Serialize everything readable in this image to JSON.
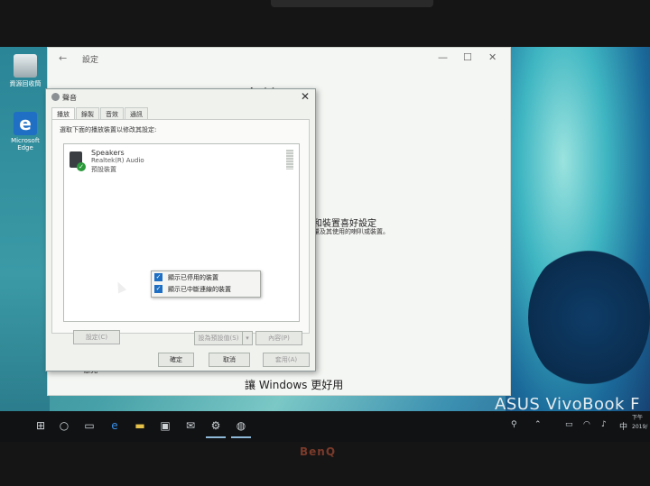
{
  "desktop": {
    "recycle_label": "資源回收筒",
    "edge_label": "Microsoft Edge"
  },
  "settings": {
    "title": "設定",
    "page_title": "音效",
    "link_text": "和裝置喜好設定",
    "link_desc": "量及其使用的喇叭或裝置。",
    "bottom_text": "讓 Windows 更好用",
    "help_item": "意見"
  },
  "dialog": {
    "title": "聲音",
    "tabs": [
      "播放",
      "錄製",
      "音效",
      "通訊"
    ],
    "instruction": "選取下面的播放裝置以修改其設定:",
    "device": {
      "name": "Speakers",
      "driver": "Realtek(R) Audio",
      "status": "預設裝置"
    },
    "context_menu": [
      {
        "label": "顯示已停用的裝置",
        "checked": true
      },
      {
        "label": "顯示已中斷連線的裝置",
        "checked": true
      }
    ],
    "buttons": {
      "configure": "設定(C)",
      "set_default": "設為預設值(S)",
      "properties": "內容(P)",
      "ok": "確定",
      "cancel": "取消",
      "apply": "套用(A)"
    }
  },
  "taskbar": {
    "tray_lang": "中",
    "tray_time": "下午",
    "tray_date": "2019/"
  },
  "brand": "ASUS VivoBook F",
  "monitor_brand": "BenQ",
  "colors": {
    "accent": "#1e6fc4",
    "taskbar": "#101214",
    "dialog_bg": "#f0f2ee"
  }
}
